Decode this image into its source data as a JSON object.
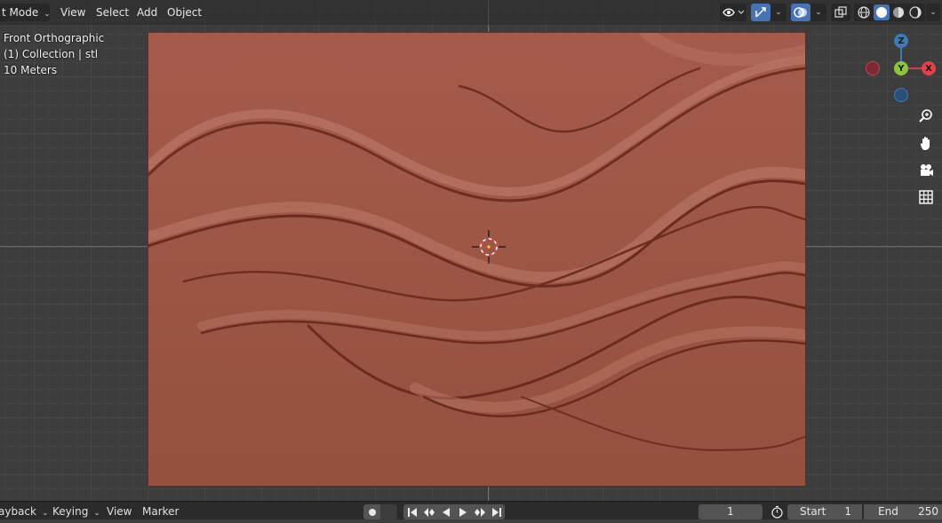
{
  "header": {
    "mode_label": "t Mode",
    "menus": [
      "View",
      "Select",
      "Add",
      "Object"
    ]
  },
  "overlay": {
    "view_name": "Front Orthographic",
    "collection": "(1) Collection | stl",
    "scale": "10 Meters"
  },
  "gizmo": {
    "z": "Z",
    "y": "Y",
    "x": "X"
  },
  "timeline": {
    "playback": "ayback",
    "keying": "Keying",
    "view": "View",
    "marker": "Marker",
    "current_frame": "1",
    "start_label": "Start",
    "start_value": "1",
    "end_label": "End",
    "end_value": "250"
  },
  "colors": {
    "relief": "#9c5447",
    "axis_x": "#b8454d",
    "axis_z": "#3f7ab8",
    "active": "#4772b3"
  }
}
